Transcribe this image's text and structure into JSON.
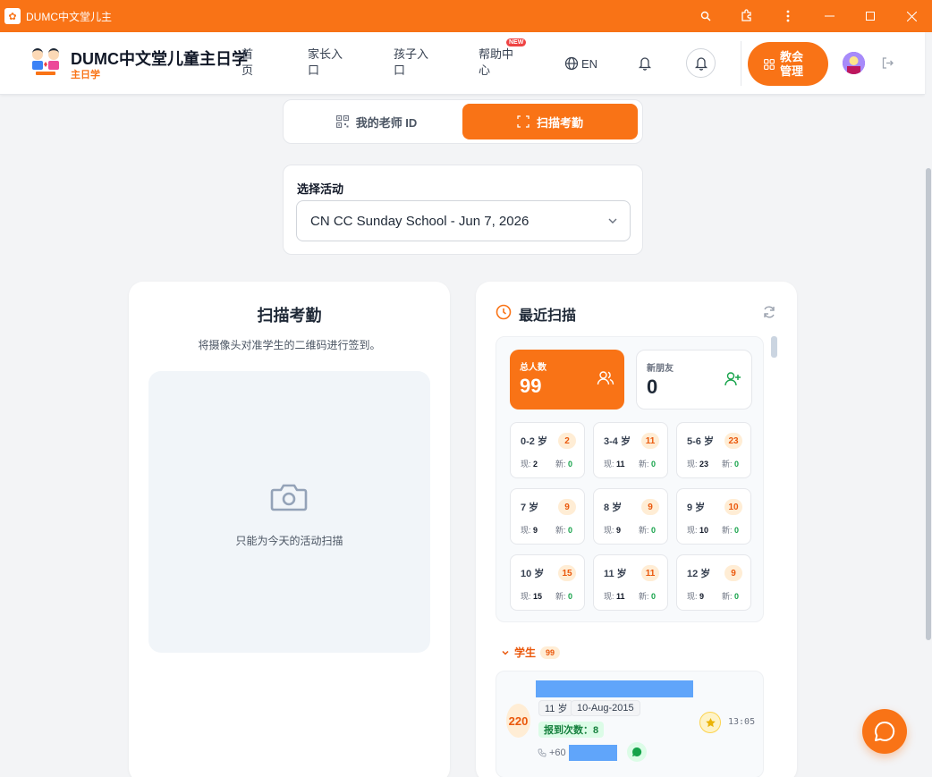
{
  "window": {
    "title": "DUMC中文堂儿主"
  },
  "header": {
    "brand": "DUMC中文堂儿童主日学",
    "brand_sub": "主日学",
    "nav": [
      {
        "label": "首页"
      },
      {
        "label": "家长入口"
      },
      {
        "label": "孩子入口"
      },
      {
        "label": "帮助中心",
        "badge": "NEW"
      }
    ],
    "lang": "EN",
    "admin_label": "教会管理"
  },
  "tabs": {
    "teacher_id": "我的老师 ID",
    "scan": "扫描考勤",
    "active": "scan"
  },
  "activity": {
    "label": "选择活动",
    "selected": "CN CC Sunday School - Jun 7, 2026"
  },
  "scan_panel": {
    "title": "扫描考勤",
    "description": "将摄像头对准学生的二维码进行签到。",
    "note": "只能为今天的活动扫描"
  },
  "recent": {
    "title": "最近扫描",
    "total_label": "总人数",
    "total_value": "99",
    "new_label": "新朋友",
    "new_value": "0",
    "present_prefix": "现:",
    "new_prefix": "新:",
    "age_groups": [
      {
        "label": "0-2 岁",
        "count": "2",
        "present": "2",
        "new": "0"
      },
      {
        "label": "3-4 岁",
        "count": "11",
        "present": "11",
        "new": "0"
      },
      {
        "label": "5-6 岁",
        "count": "23",
        "present": "23",
        "new": "0"
      },
      {
        "label": "7 岁",
        "count": "9",
        "present": "9",
        "new": "0"
      },
      {
        "label": "8 岁",
        "count": "9",
        "present": "9",
        "new": "0"
      },
      {
        "label": "9 岁",
        "count": "10",
        "present": "10",
        "new": "0"
      },
      {
        "label": "10 岁",
        "count": "15",
        "present": "15",
        "new": "0"
      },
      {
        "label": "11 岁",
        "count": "11",
        "present": "11",
        "new": "0"
      },
      {
        "label": "12 岁",
        "count": "9",
        "present": "9",
        "new": "0"
      }
    ],
    "students_label": "学生",
    "students_count": "99",
    "students": [
      {
        "id": "220",
        "age": "11 岁",
        "dob": "10-Aug-2015",
        "checkins": "报到次数：8",
        "phone_prefix": "+60",
        "time": "13:05"
      }
    ]
  },
  "colors": {
    "accent": "#f97316",
    "accent_soft": "#ffedd5",
    "success": "#16a34a"
  }
}
